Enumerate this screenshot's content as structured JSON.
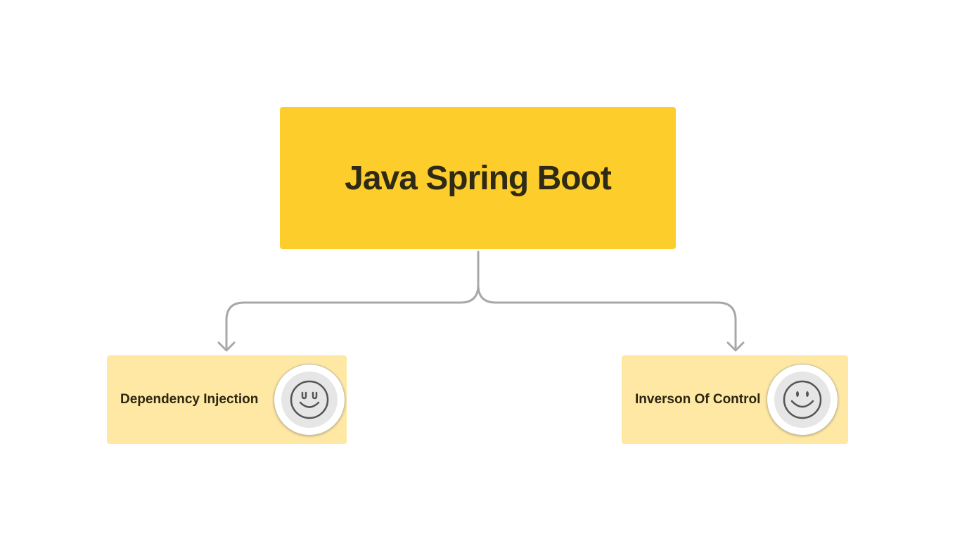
{
  "root": {
    "title": "Java Spring Boot",
    "color": "#fdcd2c"
  },
  "children": [
    {
      "label": "Dependency Injection",
      "icon": "smiley-face-icon",
      "color": "#fee8a3"
    },
    {
      "label": "Inverson Of Control",
      "icon": "smiley-face-icon",
      "color": "#fee8a3"
    }
  ],
  "connector_color": "#a8a8a8"
}
